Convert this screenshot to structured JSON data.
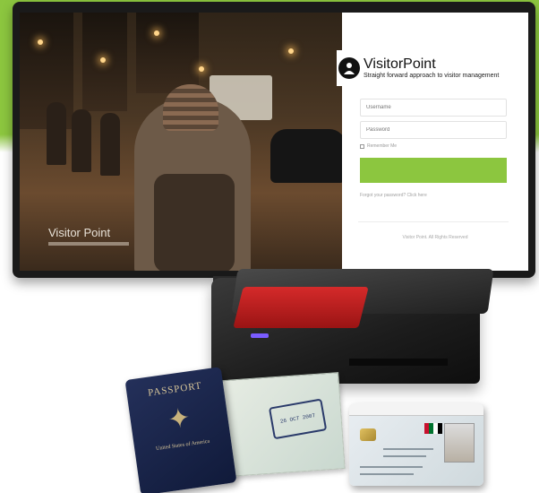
{
  "brand": {
    "name": "VisitorPoint",
    "tagline": "Straight forward approach to visitor management"
  },
  "hero": {
    "title": "Visitor Point"
  },
  "login": {
    "username_placeholder": "Username",
    "password_placeholder": "Password",
    "remember_label": "Remember Me",
    "signin_label": "",
    "forgot_label": "Forgot your password? Click here",
    "footer": "Visitor Point. All Rights Reserved"
  },
  "documents": {
    "passport_title": "PASSPORT",
    "passport_sub": "United States of America",
    "visa_stamp": "26 OCT 2007"
  },
  "colors": {
    "accent": "#8cc63f",
    "scanner_red": "#c62020"
  },
  "icons": {
    "brand_logo": "visitor-badge-icon",
    "passport_emblem": "eagle-icon"
  }
}
